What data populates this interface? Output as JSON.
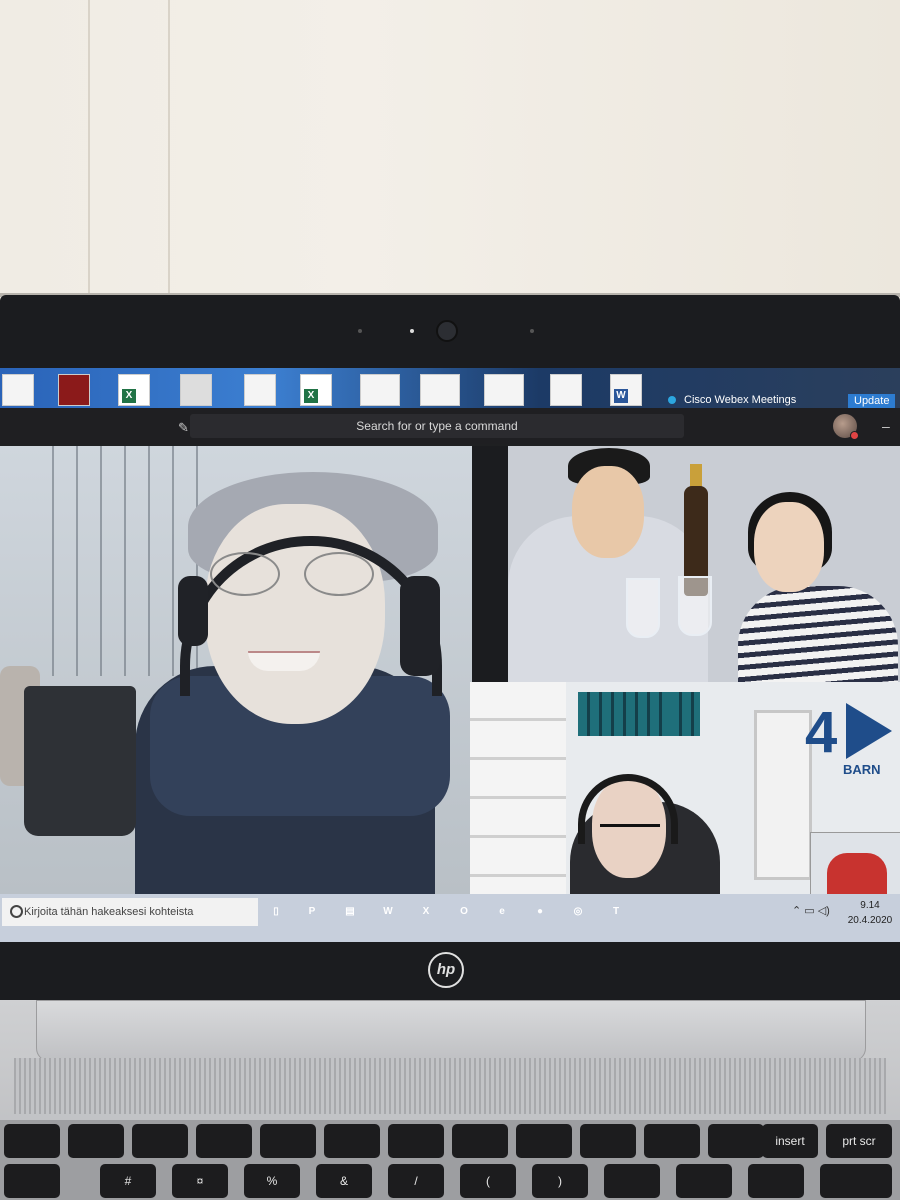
{
  "desktop": {
    "icons": [
      {
        "name": "file-icon",
        "label": ""
      },
      {
        "name": "mendeley-icon",
        "label": ""
      },
      {
        "name": "excel-file-icon",
        "label": "X"
      },
      {
        "name": "scanner-icon",
        "label": ""
      },
      {
        "name": "document-icon",
        "label": ""
      },
      {
        "name": "excel-file-icon",
        "label": "X"
      },
      {
        "name": "document-icon",
        "label": ""
      },
      {
        "name": "document-icon",
        "label": ""
      },
      {
        "name": "document-icon",
        "label": ""
      },
      {
        "name": "document-icon",
        "label": ""
      },
      {
        "name": "word-file-icon",
        "label": "W"
      }
    ],
    "webex_label": "Cisco Webex Meetings",
    "update_label": "Update"
  },
  "teams": {
    "search_placeholder": "Search for or type a command"
  },
  "video": {
    "logo_text": "4",
    "logo_subtext": "BARN"
  },
  "taskbar": {
    "search_placeholder": "Kirjoita tähän hakeaksesi kohteista",
    "apps": [
      {
        "name": "task-view-icon",
        "color": "#5b6473",
        "glyph": "▯"
      },
      {
        "name": "powerpoint-icon",
        "color": "#c4472a",
        "glyph": "P"
      },
      {
        "name": "file-explorer-icon",
        "color": "#d9a72a",
        "glyph": "▤"
      },
      {
        "name": "word-icon",
        "color": "#2b579a",
        "glyph": "W"
      },
      {
        "name": "excel-icon",
        "color": "#217346",
        "glyph": "X"
      },
      {
        "name": "outlook-icon",
        "color": "#0f6cbd",
        "glyph": "O"
      },
      {
        "name": "edge-icon",
        "color": "#1f7ad6",
        "glyph": "e"
      },
      {
        "name": "chrome-icon",
        "color": "#d24a3c",
        "glyph": "●"
      },
      {
        "name": "webex-icon",
        "color": "#2ca7e0",
        "glyph": "◎"
      },
      {
        "name": "teams-icon",
        "color": "#5b5fc7",
        "glyph": "T"
      }
    ],
    "time": "9.14",
    "date": "20.4.2020"
  },
  "laptop": {
    "brand": "hp"
  },
  "keyboard": {
    "row1": [
      "",
      "",
      "",
      "",
      "",
      "",
      "",
      "",
      "",
      "",
      "",
      "",
      "insert",
      "prt scr"
    ],
    "row2": [
      "",
      "#",
      "¤",
      "%",
      "&",
      "/",
      "(",
      ")",
      "",
      "",
      "",
      ""
    ]
  }
}
